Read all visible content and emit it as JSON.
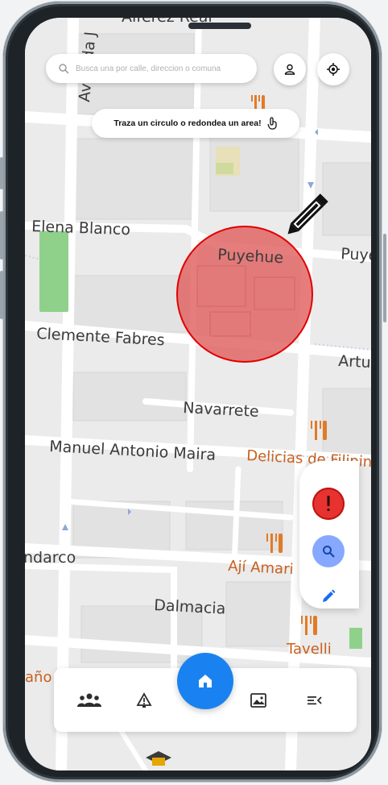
{
  "map": {
    "streets": [
      "Alférez Real",
      "Avenida J",
      "Elena Blanco",
      "Puyehue",
      "Puye",
      "Clemente Fabres",
      "Artu",
      "Navarrete",
      "Manuel Antonio Maira",
      "ndarco",
      "Dalmacia",
      "año"
    ],
    "pois": [
      "Delicias de Filipin",
      "Ají Amari",
      "Tavelli"
    ],
    "selection_color": "#e06060",
    "selection_stroke": "#e20000"
  },
  "search": {
    "placeholder": "Busca una por calle, direccion o comuna",
    "icon": "search-icon"
  },
  "header": {
    "profile_icon": "person-icon",
    "location_icon": "crosshair-icon"
  },
  "hint": {
    "text": "Traza un circulo o redondea un area!",
    "icon": "touch-icon"
  },
  "tools": [
    {
      "name": "alert",
      "icon": "exclamation-icon",
      "color": "#e8322f"
    },
    {
      "name": "search",
      "icon": "search-icon",
      "color": "#7fa8ff"
    },
    {
      "name": "edit",
      "icon": "pencil-icon",
      "color": "#1a6cf0"
    }
  ],
  "nav": {
    "items": [
      "group-icon",
      "alert-triangle-icon",
      "home-icon",
      "image-icon",
      "menu-close-icon"
    ],
    "accent": "#1a82f0"
  }
}
